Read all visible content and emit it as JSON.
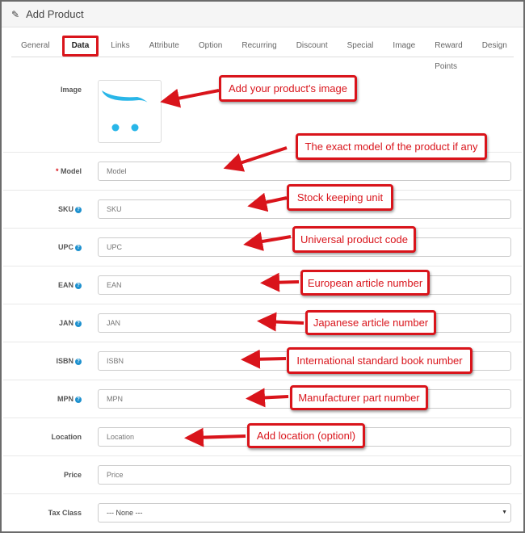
{
  "header": {
    "title": "Add Product",
    "icon": "pencil-icon"
  },
  "tabs": [
    "General",
    "Data",
    "Links",
    "Attribute",
    "Option",
    "Recurring",
    "Discount",
    "Special",
    "Image",
    "Reward Points",
    "Design"
  ],
  "active_tab": "Data",
  "image_label": "Image",
  "fields": [
    {
      "label": "Model",
      "required": true,
      "help": false,
      "placeholder": "Model"
    },
    {
      "label": "SKU",
      "help": true,
      "placeholder": "SKU"
    },
    {
      "label": "UPC",
      "help": true,
      "placeholder": "UPC"
    },
    {
      "label": "EAN",
      "help": true,
      "placeholder": "EAN"
    },
    {
      "label": "JAN",
      "help": true,
      "placeholder": "JAN"
    },
    {
      "label": "ISBN",
      "help": true,
      "placeholder": "ISBN"
    },
    {
      "label": "MPN",
      "help": true,
      "placeholder": "MPN"
    },
    {
      "label": "Location",
      "help": false,
      "placeholder": "Location"
    },
    {
      "label": "Price",
      "help": false,
      "placeholder": "Price"
    },
    {
      "label": "Tax Class",
      "help": false,
      "value": "--- None ---",
      "select": true
    }
  ],
  "callouts": [
    "Add your product's image",
    "The exact model of the product if any",
    "Stock keeping unit",
    "Universal product code",
    "European article number",
    "Japanese article number",
    "International standard book number",
    "Manufacturer part number",
    "Add location (optionl)"
  ],
  "colors": {
    "annotation": "#d9141b",
    "help": "#1e91cf",
    "logo": "#29b6e8"
  }
}
